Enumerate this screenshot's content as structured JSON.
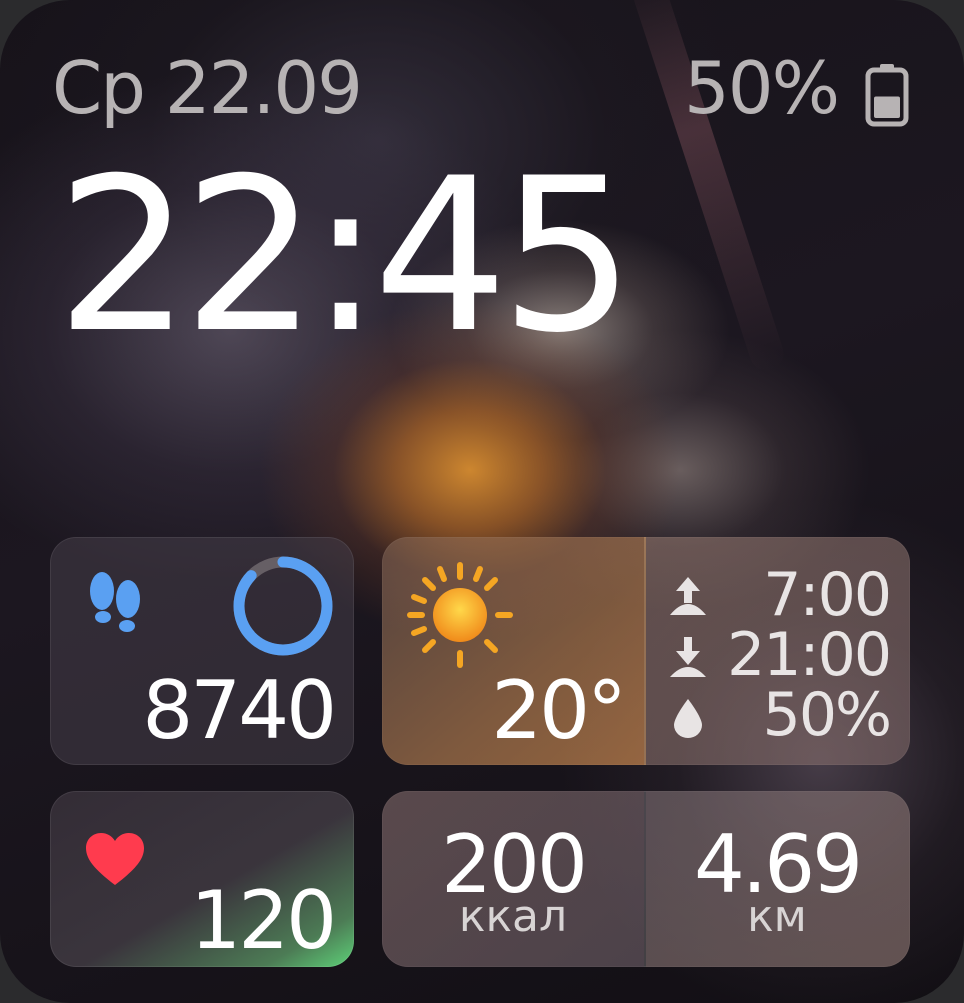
{
  "status": {
    "date": "Ср 22.09",
    "battery_percent_text": "50%",
    "battery_level": 0.5,
    "battery_icon": "battery-icon"
  },
  "clock": {
    "time": "22:45"
  },
  "steps": {
    "icon": "footprints-icon",
    "value": "8740",
    "progress_fraction": 0.87,
    "ring_color": "#5aa0f2",
    "icon_color": "#5aa0f2"
  },
  "weather": {
    "icon": "sun-icon",
    "temperature": "20°",
    "sunrise_icon": "sunrise-icon",
    "sunrise": "7:00",
    "sunset_icon": "sunset-icon",
    "sunset": "21:00",
    "humidity_icon": "water-drop-icon",
    "humidity": "50%"
  },
  "heart": {
    "icon": "heart-icon",
    "value": "120",
    "color": "#ff3b4e"
  },
  "calories": {
    "value": "200",
    "unit": "ккал"
  },
  "distance": {
    "value": "4.69",
    "unit": "км"
  }
}
